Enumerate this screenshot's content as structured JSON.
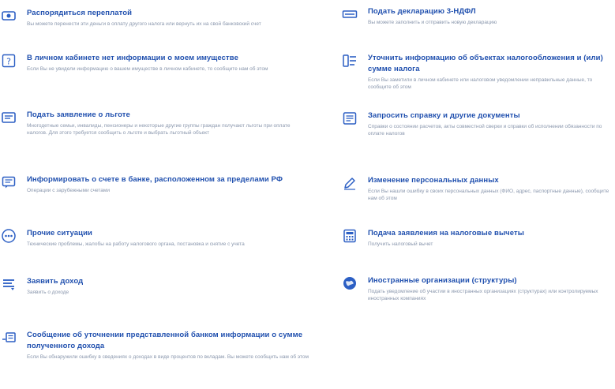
{
  "left_items": [
    {
      "icon": "hand-coins-icon",
      "title": "Распорядиться переплатой",
      "desc": "Вы можете перенести эти деньги в оплату другого налога или вернуть их на свой банковский счет"
    },
    {
      "icon": "question-icon",
      "title": "В личном кабинете нет информации о моем имуществе",
      "desc": "Если Вы не увидели информацию о вашем имуществе в личном кабинете, то сообщите нам об этом"
    },
    {
      "icon": "document-icon",
      "title": "Подать заявление о льготе",
      "desc": "Многодетные семьи, инвалиды, пенсионеры и некоторые другие группы граждан получают льготы при оплате налогов. Для этого требуется сообщить о льготе и выбрать льготный объект"
    },
    {
      "icon": "chat-icon",
      "title": "Информировать о счете в банке, расположенном за пределами РФ",
      "desc": "Операции с зарубежными счетами"
    },
    {
      "icon": "more-icon",
      "title": "Прочие ситуации",
      "desc": "Технические проблемы, жалобы на работу налогового органа, постановка и снятие с учета"
    },
    {
      "icon": "income-icon",
      "title": "Заявить доход",
      "desc": "Заявить о доходе"
    },
    {
      "icon": "bank-message-icon",
      "title": "Сообщение об уточнении представленной банком информации о сумме полученного дохода",
      "desc": "Если Вы обнаружили ошибку в сведениях о доходах в виде процентов по вкладам. Вы можете сообщить нам об этом"
    }
  ],
  "right_items": [
    {
      "icon": "declaration-icon",
      "title": "Подать декларацию 3-НДФЛ",
      "desc": "Вы можете заполнить и отправить новую декларацию"
    },
    {
      "icon": "list-icon",
      "title": "Уточнить информацию об объектах налогообложения и (или) сумме налога",
      "desc": "Если Вы заметили в личном кабинете или налоговом уведомлении неправильные данные, то сообщите об этом"
    },
    {
      "icon": "request-icon",
      "title": "Запросить справку и другие документы",
      "desc": "Справки о состоянии расчетов, акты совместной сверки и справки об исполнении обязанности по оплате налогов"
    },
    {
      "icon": "pencil-icon",
      "title": "Изменение персональных данных",
      "desc": "Если Вы нашли ошибку в своих персональных данных (ФИО, адрес, паспортные данные), сообщите нам об этом"
    },
    {
      "icon": "calculator-icon",
      "title": "Подача заявления на налоговые вычеты",
      "desc": "Получить налоговый вычет"
    },
    {
      "icon": "globe-icon",
      "title": "Иностранные организации (структуры)",
      "desc": "Подать уведомление об участии в иностранных организациях (структурах) или контролируемых иностранных компаниях"
    }
  ],
  "colors": {
    "title": "#1f4fae",
    "desc": "#8a97ad",
    "icon": "#2c5fc4"
  }
}
